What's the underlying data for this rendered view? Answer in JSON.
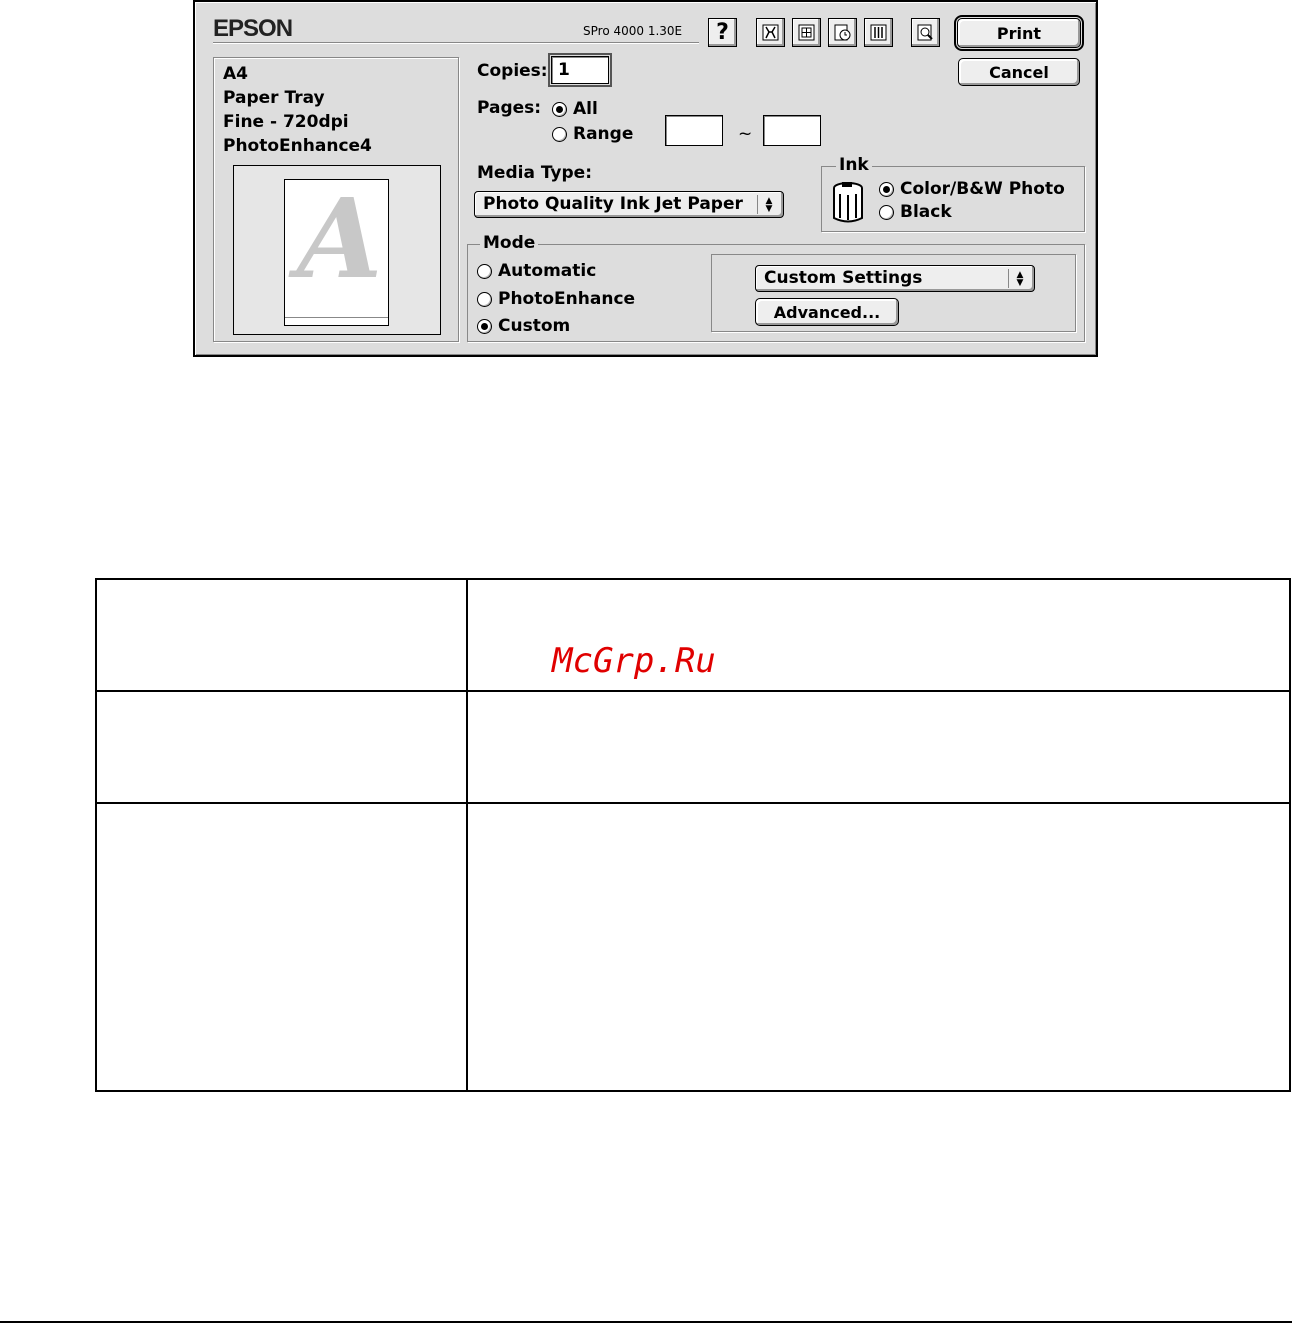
{
  "dialog": {
    "brand": "EPSON",
    "version": "SPro 4000 1.30E",
    "toolbar": [
      {
        "name": "help-icon",
        "glyph": "?"
      },
      {
        "name": "utility-icon"
      },
      {
        "name": "layout-icon"
      },
      {
        "name": "background-print-icon"
      },
      {
        "name": "color-management-icon"
      },
      {
        "name": "preview-icon"
      }
    ],
    "buttons": {
      "print": "Print",
      "cancel": "Cancel",
      "advanced": "Advanced..."
    },
    "summary": {
      "lines": [
        "A4",
        "Paper Tray",
        "Fine - 720dpi",
        "PhotoEnhance4"
      ],
      "preview_glyph": "A"
    },
    "copies": {
      "label": "Copies:",
      "value": "1"
    },
    "pages": {
      "label": "Pages:",
      "options": [
        {
          "label": "All",
          "selected": true
        },
        {
          "label": "Range",
          "selected": false
        }
      ],
      "range_separator": "~",
      "range_from": "",
      "range_to": ""
    },
    "media_type": {
      "label": "Media Type:",
      "value": "Photo Quality Ink Jet Paper"
    },
    "ink": {
      "title": "Ink",
      "options": [
        {
          "label": "Color/B&W Photo",
          "selected": true
        },
        {
          "label": "Black",
          "selected": false
        }
      ]
    },
    "mode": {
      "title": "Mode",
      "options": [
        {
          "label": "Automatic",
          "selected": false
        },
        {
          "label": "PhotoEnhance",
          "selected": false
        },
        {
          "label": "Custom",
          "selected": true
        }
      ],
      "custom_settings": "Custom Settings"
    }
  },
  "watermark": "McGrp.Ru",
  "colors": {
    "dialog_bg": "#dddddd",
    "watermark": "#e00000"
  }
}
